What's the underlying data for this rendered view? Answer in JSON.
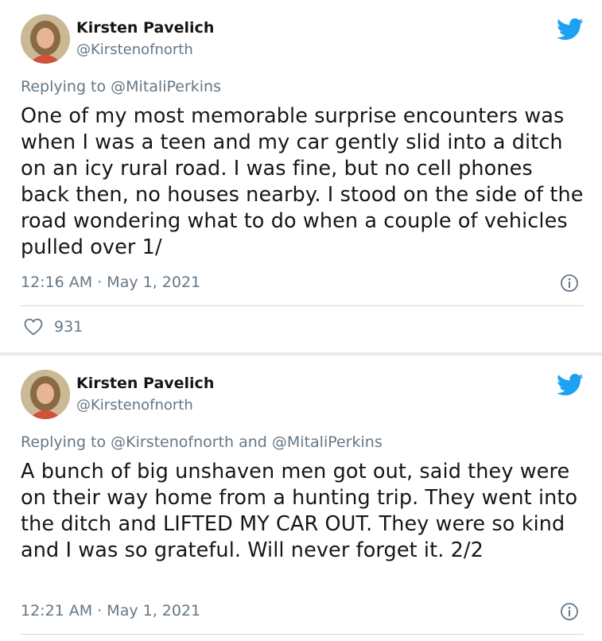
{
  "tweets": [
    {
      "author_name": "Kirsten Pavelich",
      "author_handle": "@Kirstenofnorth",
      "reply_prefix": "Replying to ",
      "reply_to": "@MitaliPerkins",
      "text": "One of my most memorable surprise encounters was when I was a teen and my car gently slid into a ditch on an icy rural road. I was fine, but no cell phones back then, no houses nearby. I stood on the side of the road wondering what to do when a couple of vehicles pulled over 1/",
      "timestamp": "12:16 AM · May 1, 2021",
      "like_count": "931"
    },
    {
      "author_name": "Kirsten Pavelich",
      "author_handle": "@Kirstenofnorth",
      "reply_prefix": "Replying to ",
      "reply_to": "@Kirstenofnorth and @MitaliPerkins",
      "text": "A bunch of big unshaven men got out, said they were on their way home from a hunting trip. They went into the ditch and LIFTED MY CAR OUT. They were so kind and I was so grateful. Will never forget it. 2/2",
      "timestamp": "12:21 AM · May 1, 2021"
    }
  ],
  "icons": {
    "brand": "twitter-bird-icon",
    "info": "info-icon",
    "like": "heart-icon"
  },
  "colors": {
    "twitter_blue": "#1da1f2",
    "secondary_text": "#657786",
    "primary_text": "#14171a",
    "divider": "#ccd6dd"
  }
}
